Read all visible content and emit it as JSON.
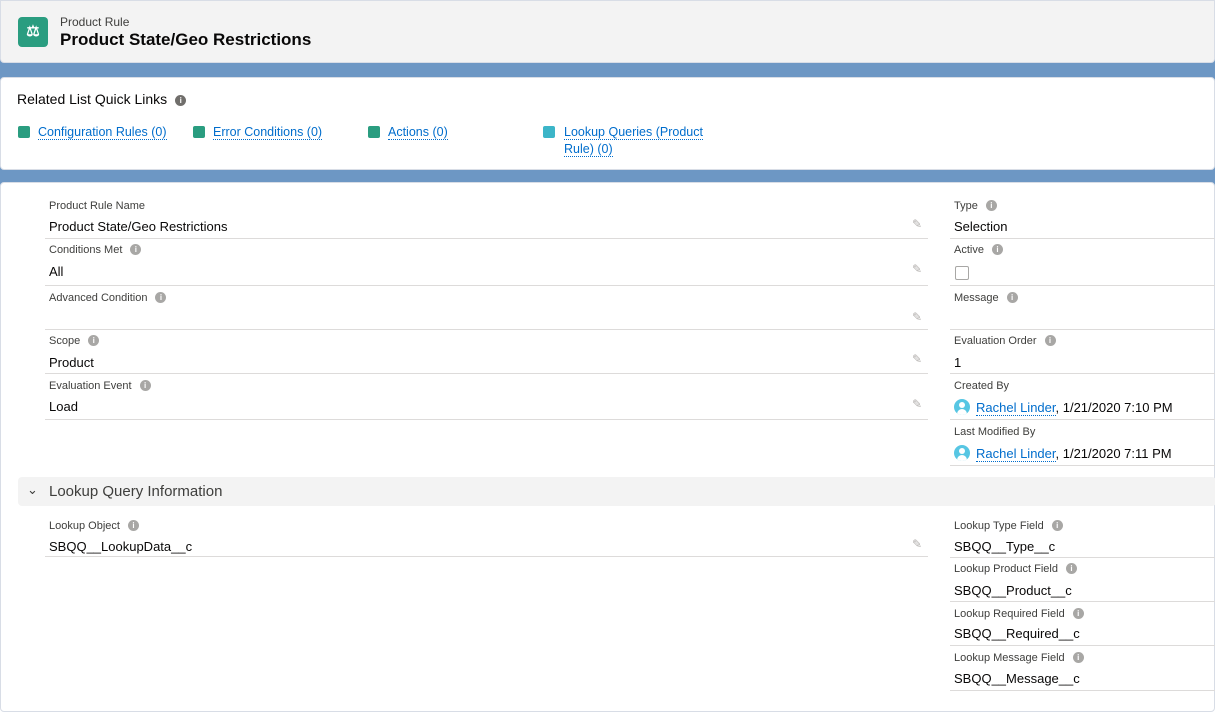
{
  "header": {
    "object": "Product Rule",
    "title": "Product State/Geo Restrictions",
    "icon": "scales-icon"
  },
  "quick_links": {
    "title": "Related List Quick Links",
    "links": [
      {
        "label": "Configuration Rules (0)"
      },
      {
        "label": "Error Conditions (0)"
      },
      {
        "label": "Actions (0)"
      },
      {
        "label": "Lookup Queries (Product",
        "label2": "Rule) (0)"
      }
    ]
  },
  "left_fields": [
    {
      "label": "Product Rule Name",
      "value": "Product State/Geo Restrictions"
    },
    {
      "label": "Conditions Met",
      "value": "All"
    },
    {
      "label": "Advanced Condition",
      "value": ""
    },
    {
      "label": "Scope",
      "value": "Product"
    },
    {
      "label": "Evaluation Event",
      "value": "Load"
    }
  ],
  "right_fields": {
    "type": {
      "label": "Type",
      "value": "Selection"
    },
    "active": {
      "label": "Active",
      "checked": false
    },
    "message": {
      "label": "Message",
      "value": ""
    },
    "evaluation_order": {
      "label": "Evaluation Order",
      "value": "1"
    },
    "created_by": {
      "label": "Created By",
      "user": "Rachel Linder",
      "date": ", 1/21/2020 7:10 PM"
    },
    "last_modified_by": {
      "label": "Last Modified By",
      "user": "Rachel Linder",
      "date": ", 1/21/2020 7:11 PM"
    }
  },
  "section": {
    "title": "Lookup Query Information"
  },
  "lookup": {
    "object": {
      "label": "Lookup Object",
      "value": "SBQQ__LookupData__c"
    },
    "right": [
      {
        "label": "Lookup Type Field",
        "value": "SBQQ__Type__c"
      },
      {
        "label": "Lookup Product Field",
        "value": "SBQQ__Product__c"
      },
      {
        "label": "Lookup Required Field",
        "value": "SBQQ__Required__c"
      },
      {
        "label": "Lookup Message Field",
        "value": "SBQQ__Message__c"
      }
    ]
  },
  "colors": {
    "brand": "#2a9d80",
    "link": "#006dcc",
    "banner": "#6d97c4"
  }
}
